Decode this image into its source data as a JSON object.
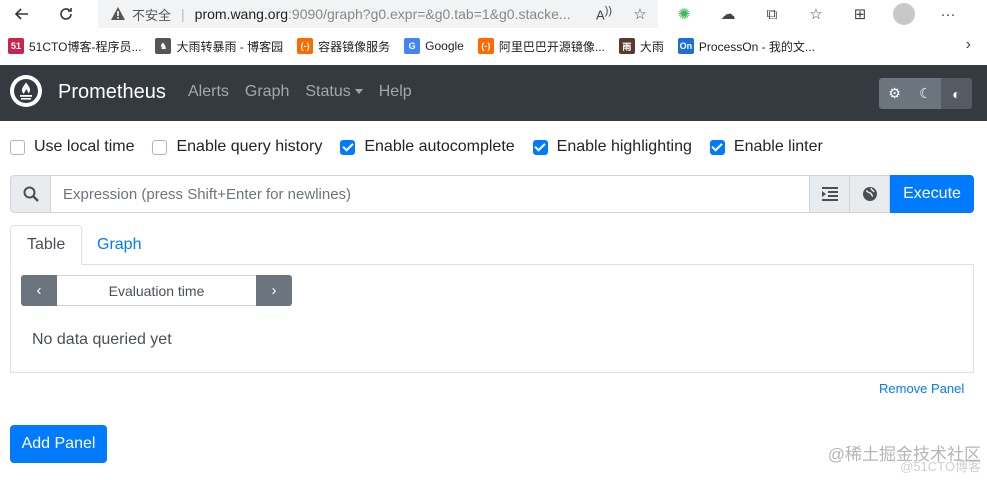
{
  "browser": {
    "insecure_label": "不安全",
    "url_main": "prom.wang.org",
    "url_rest": ":9090/graph?g0.expr=&g0.tab=1&g0.stacke...",
    "bookmarks": [
      {
        "label": "51CTO博客-程序员...",
        "icon_text": "51",
        "color": "#c7254e"
      },
      {
        "label": "大雨转暴雨 - 博客园",
        "icon_text": "♞",
        "color": "#555555"
      },
      {
        "label": "容器镜像服务",
        "icon_text": "(-)",
        "color": "#ff6a00"
      },
      {
        "label": "Google",
        "icon_text": "G",
        "color": "#4285f4"
      },
      {
        "label": "阿里巴巴开源镜像...",
        "icon_text": "(-)",
        "color": "#ff6a00"
      },
      {
        "label": "大雨",
        "icon_text": "雨",
        "color": "#5a3a2e"
      },
      {
        "label": "ProcessOn - 我的文...",
        "icon_text": "On",
        "color": "#1e6fd9"
      }
    ]
  },
  "navbar": {
    "brand": "Prometheus",
    "links": [
      "Alerts",
      "Graph",
      "Status",
      "Help"
    ]
  },
  "options": [
    {
      "label": "Use local time",
      "checked": false
    },
    {
      "label": "Enable query history",
      "checked": false
    },
    {
      "label": "Enable autocomplete",
      "checked": true
    },
    {
      "label": "Enable highlighting",
      "checked": true
    },
    {
      "label": "Enable linter",
      "checked": true
    }
  ],
  "expression": {
    "placeholder": "Expression (press Shift+Enter for newlines)",
    "execute_label": "Execute"
  },
  "tabs": {
    "table_label": "Table",
    "graph_label": "Graph"
  },
  "panel": {
    "eval_placeholder": "Evaluation time",
    "no_data": "No data queried yet",
    "remove_label": "Remove Panel"
  },
  "add_panel_label": "Add Panel",
  "watermark": {
    "main": "@稀土掘金技术社区",
    "sub": "@51CTO博客"
  }
}
